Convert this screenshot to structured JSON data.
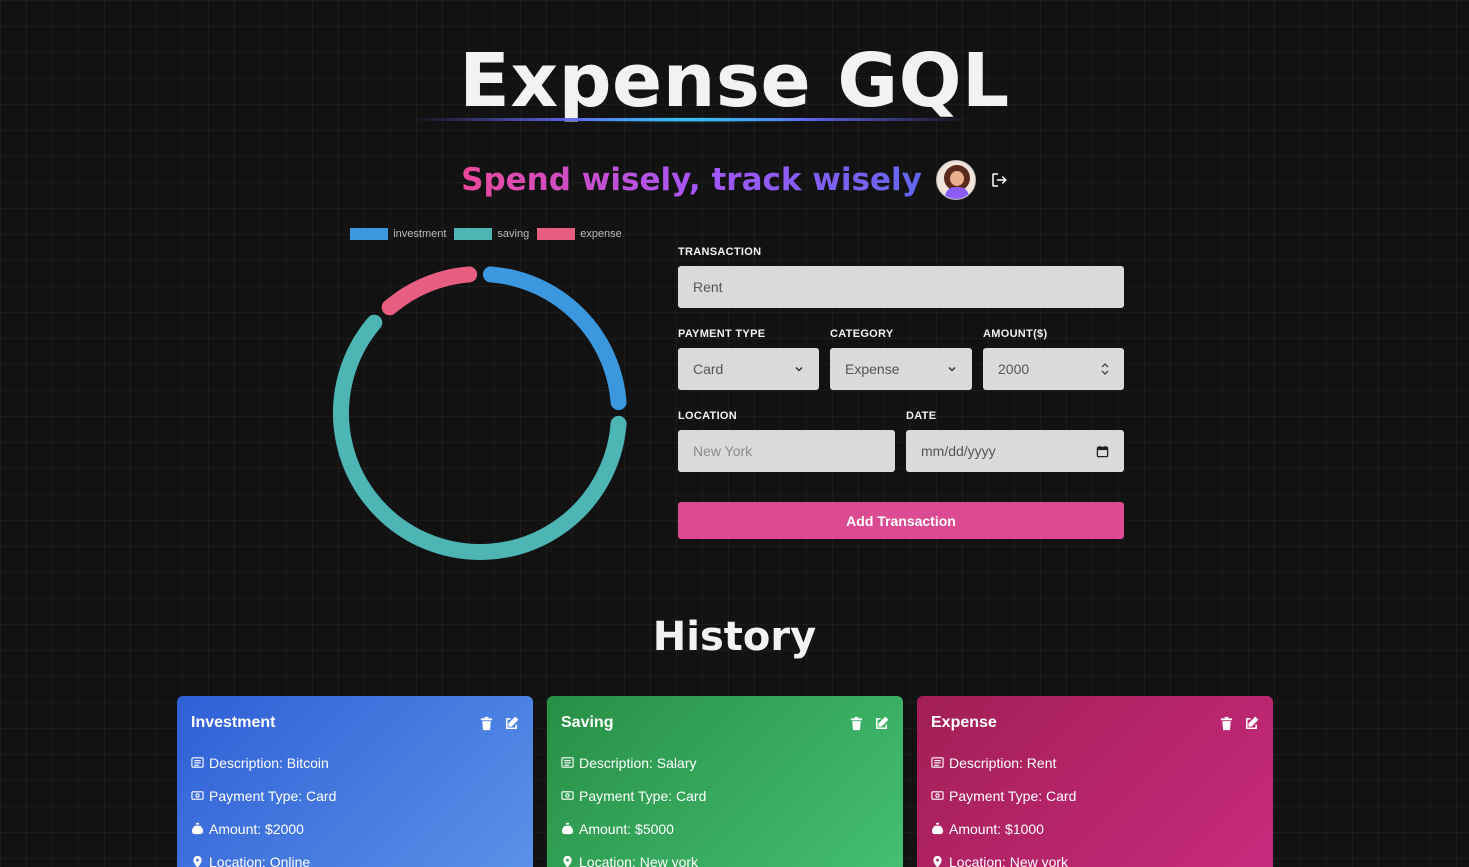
{
  "header": {
    "title": "Expense GQL",
    "tagline": "Spend wisely, track wisely"
  },
  "chart_data": {
    "type": "pie",
    "variant": "doughnut",
    "categories": [
      "investment",
      "saving",
      "expense"
    ],
    "values": [
      2000,
      5000,
      1000
    ],
    "colors": [
      "#3b97de",
      "#4db6b5",
      "#e85e80"
    ],
    "legend_position": "top"
  },
  "form": {
    "transaction_label": "TRANSACTION",
    "transaction_value": "Rent",
    "payment_type_label": "PAYMENT TYPE",
    "payment_type_value": "Card",
    "category_label": "CATEGORY",
    "category_value": "Expense",
    "amount_label": "AMOUNT($)",
    "amount_value": "2000",
    "location_label": "LOCATION",
    "location_placeholder": "New York",
    "date_label": "DATE",
    "date_placeholder": "mm/dd/yyyy",
    "submit_label": "Add Transaction"
  },
  "history": {
    "title": "History",
    "cards": [
      {
        "category": "Investment",
        "description": "Description: Bitcoin",
        "payment": "Payment Type: Card",
        "amount": "Amount: $2000",
        "location": "Location: Online"
      },
      {
        "category": "Saving",
        "description": "Description: Salary",
        "payment": "Payment Type: Card",
        "amount": "Amount: $5000",
        "location": "Location: New york"
      },
      {
        "category": "Expense",
        "description": "Description: Rent",
        "payment": "Payment Type: Card",
        "amount": "Amount: $1000",
        "location": "Location: New york"
      }
    ]
  },
  "colors": {
    "accent_pink": "#dc4b92",
    "investment": "#3b97de",
    "saving": "#4db6b5",
    "expense": "#e85e80"
  }
}
